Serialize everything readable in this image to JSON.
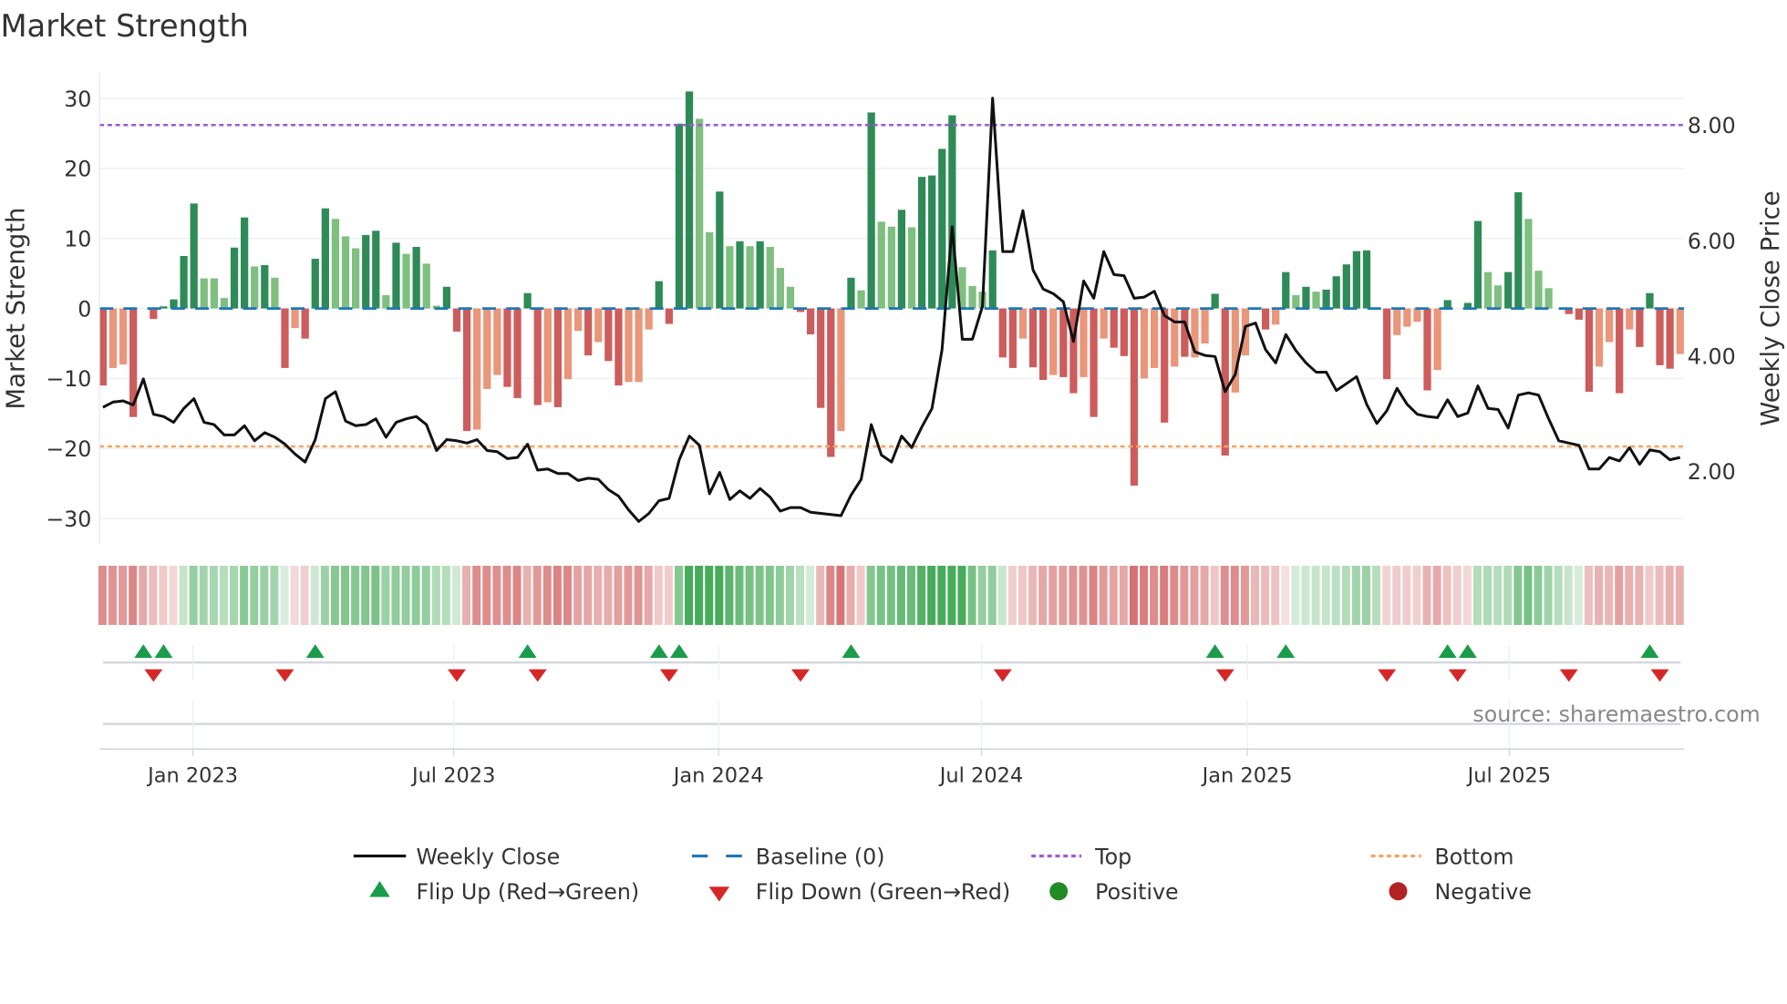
{
  "chart_data": {
    "type": "bar",
    "title": "Market Strength",
    "ylabel": "Market Strength",
    "y2label": "Weekly Close Price",
    "ylim": [
      -35,
      35.5
    ],
    "yticks": [
      30,
      20,
      10,
      0,
      -10,
      -20,
      -30
    ],
    "ytick_labels": [
      "30",
      "20",
      "10",
      "0",
      "−10",
      "−20",
      "−30"
    ],
    "y2ticks": [
      8,
      6,
      4,
      2
    ],
    "y2tick_labels": [
      "8.00",
      "6.00",
      "4.00",
      "2.00"
    ],
    "xtick_labels": [
      "Jan 2023",
      "Jul 2023",
      "Jan 2024",
      "Jul 2024",
      "Jan 2025",
      "Jul 2025"
    ],
    "xtick_week_index": [
      8.9,
      34.7,
      60.9,
      86.9,
      113.2,
      139.1
    ],
    "top_level": 26.2,
    "bottom_level": -19.7,
    "baseline": 0,
    "strength": [
      -11,
      -8.5,
      -8,
      -15.5,
      0,
      -1.5,
      0.3,
      1.3,
      7.5,
      15,
      4.3,
      4.3,
      1.5,
      8.7,
      13,
      6,
      6.2,
      4.4,
      -8.5,
      -2.8,
      -4.3,
      7.1,
      14.3,
      12.8,
      10.3,
      8.6,
      10.5,
      11.1,
      1.9,
      9.4,
      7.8,
      8.8,
      6.4,
      0.4,
      3.1,
      -3.3,
      -17.5,
      -17.3,
      -11.5,
      -9.5,
      -11.2,
      -12.8,
      2.2,
      -13.8,
      -13.4,
      -14.1,
      -10.1,
      -3.2,
      -6.7,
      -4.8,
      -7.5,
      -11,
      -10.5,
      -10.5,
      -3,
      3.9,
      -2.2,
      26.4,
      31,
      27.1,
      10.9,
      16.7,
      8.9,
      9.6,
      8.9,
      9.6,
      8.8,
      5.8,
      3.1,
      -0.5,
      -3.7,
      -14.2,
      -21.2,
      -17.5,
      4.4,
      2.6,
      28,
      12.4,
      11.7,
      14.1,
      11.6,
      18.8,
      19,
      22.8,
      27.6,
      5.9,
      3.2,
      2.4,
      8.3,
      -7,
      -8.5,
      -4.3,
      -8.4,
      -10.2,
      -9.5,
      -9.8,
      -12.1,
      -9.8,
      -15.5,
      -4.3,
      -5.6,
      -6.8,
      -25.3,
      -10,
      -8.5,
      -16.3,
      -8.3,
      -6.9,
      -7,
      -5,
      2.1,
      -21,
      -12,
      -6.7,
      0,
      -3,
      -2.3,
      5.2,
      1.9,
      3.1,
      2.4,
      2.7,
      4.6,
      6.3,
      8.2,
      8.3,
      0,
      -10.1,
      -3.8,
      -2.6,
      -1.9,
      -11.7,
      -8.8,
      1.2,
      0,
      0.8,
      12.5,
      5.2,
      3.3,
      5.2,
      16.6,
      12.8,
      5.4,
      2.9,
      0,
      -0.8,
      -1.6,
      -11.9,
      -8.3,
      -4.8,
      -12.1,
      -3,
      -5.5,
      2.2,
      -8.1,
      -8.6,
      -6.5
    ],
    "shade": "RrrR0RGGGGgggGGgGgRrRGGgggGGgGgGggGRRrrrRRGRrRrrRrRRrrrGRGGggGgGgGgggRRRRrGgGggGgGGGGgggGRRrRRrRRrRrRRRrrRrRrrGRrr0RrGgGgGGGGG0RrrrRrG0GGggGGggg0RRRrrRrRGRRr",
    "weekly_close": [
      3.11,
      3.2,
      3.22,
      3.15,
      3.6,
      2.99,
      2.95,
      2.85,
      3.09,
      3.26,
      2.85,
      2.81,
      2.63,
      2.63,
      2.79,
      2.53,
      2.67,
      2.59,
      2.47,
      2.3,
      2.16,
      2.55,
      3.26,
      3.38,
      2.87,
      2.79,
      2.81,
      2.91,
      2.59,
      2.85,
      2.91,
      2.95,
      2.81,
      2.36,
      2.55,
      2.53,
      2.49,
      2.55,
      2.36,
      2.34,
      2.22,
      2.24,
      2.47,
      2.02,
      2.04,
      1.96,
      1.96,
      1.84,
      1.88,
      1.86,
      1.68,
      1.57,
      1.33,
      1.13,
      1.27,
      1.49,
      1.53,
      2.2,
      2.61,
      2.45,
      1.61,
      1.98,
      1.51,
      1.66,
      1.53,
      1.7,
      1.55,
      1.31,
      1.37,
      1.37,
      1.29,
      1.27,
      1.25,
      1.23,
      1.59,
      1.86,
      2.81,
      2.28,
      2.16,
      2.61,
      2.41,
      2.77,
      3.09,
      4.11,
      6.24,
      4.29,
      4.29,
      4.86,
      8.47,
      5.81,
      5.81,
      6.52,
      5.49,
      5.16,
      5.08,
      4.94,
      4.25,
      5.3,
      5.0,
      5.81,
      5.41,
      5.39,
      5.0,
      5.02,
      5.12,
      4.7,
      4.59,
      4.59,
      4.07,
      4.01,
      3.99,
      3.38,
      3.68,
      4.51,
      4.57,
      4.11,
      3.88,
      4.37,
      4.09,
      3.88,
      3.72,
      3.72,
      3.4,
      3.52,
      3.64,
      3.16,
      2.83,
      3.05,
      3.44,
      3.16,
      2.99,
      2.95,
      2.93,
      3.24,
      2.95,
      3.01,
      3.48,
      3.09,
      3.07,
      2.75,
      3.32,
      3.36,
      3.32,
      2.91,
      2.53,
      2.49,
      2.45,
      2.04,
      2.04,
      2.24,
      2.18,
      2.41,
      2.12,
      2.37,
      2.34,
      2.2,
      2.24
    ],
    "flip_up_weeks": [
      5,
      7,
      22,
      43,
      56,
      58,
      75,
      111,
      118,
      134,
      136,
      154
    ],
    "flip_down_weeks": [
      6,
      19,
      36,
      44,
      57,
      70,
      90,
      112,
      128,
      135,
      146,
      155
    ],
    "legend": {
      "placement": "bottom",
      "weekly_close": "Weekly Close",
      "baseline": "Baseline (0)",
      "top": "Top",
      "bottom": "Bottom",
      "flip_up": "Flip Up (Red→Green)",
      "flip_down": "Flip Down (Green→Red)",
      "positive": "Positive",
      "negative": "Negative"
    },
    "source": "source: sharemaestro.com",
    "colors": {
      "strong_pos": "#2e8b57",
      "weak_pos": "#7fbf7f",
      "strong_neg": "#cd5c5c",
      "weak_neg": "#e9967a",
      "close": "#111111",
      "baseline": "#1f77b4",
      "top": "#9b59d6",
      "bottom": "#f4a460",
      "flip_up": "#1a9c4a",
      "flip_down": "#d62728",
      "positive": "#228b22",
      "negative": "#b22222"
    }
  }
}
